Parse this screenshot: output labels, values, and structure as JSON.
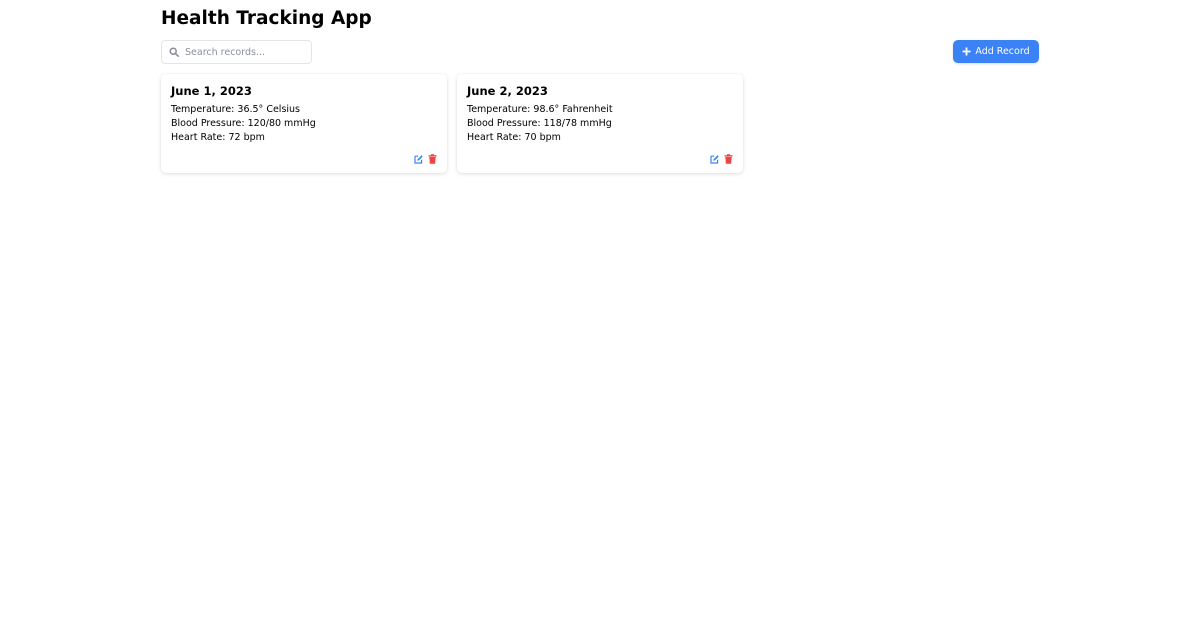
{
  "app": {
    "title": "Health Tracking App"
  },
  "search": {
    "placeholder": "Search records...",
    "value": "",
    "icon": "search-icon"
  },
  "toolbar": {
    "add_label": "Add Record",
    "add_icon": "plus-icon",
    "accent_color": "#3b82f6"
  },
  "records": [
    {
      "date": "June 1, 2023",
      "temperature": "Temperature: 36.5° Celsius",
      "blood_pressure": "Blood Pressure: 120/80 mmHg",
      "heart_rate": "Heart Rate: 72 bpm",
      "actions": [
        "edit-icon",
        "trash-icon"
      ]
    },
    {
      "date": "June 2, 2023",
      "temperature": "Temperature: 98.6° Fahrenheit",
      "blood_pressure": "Blood Pressure: 118/78 mmHg",
      "heart_rate": "Heart Rate: 70 bpm",
      "actions": [
        "edit-icon",
        "trash-icon"
      ]
    }
  ],
  "colors": {
    "edit_icon": "#3b82f6",
    "delete_icon": "#ef4444"
  }
}
